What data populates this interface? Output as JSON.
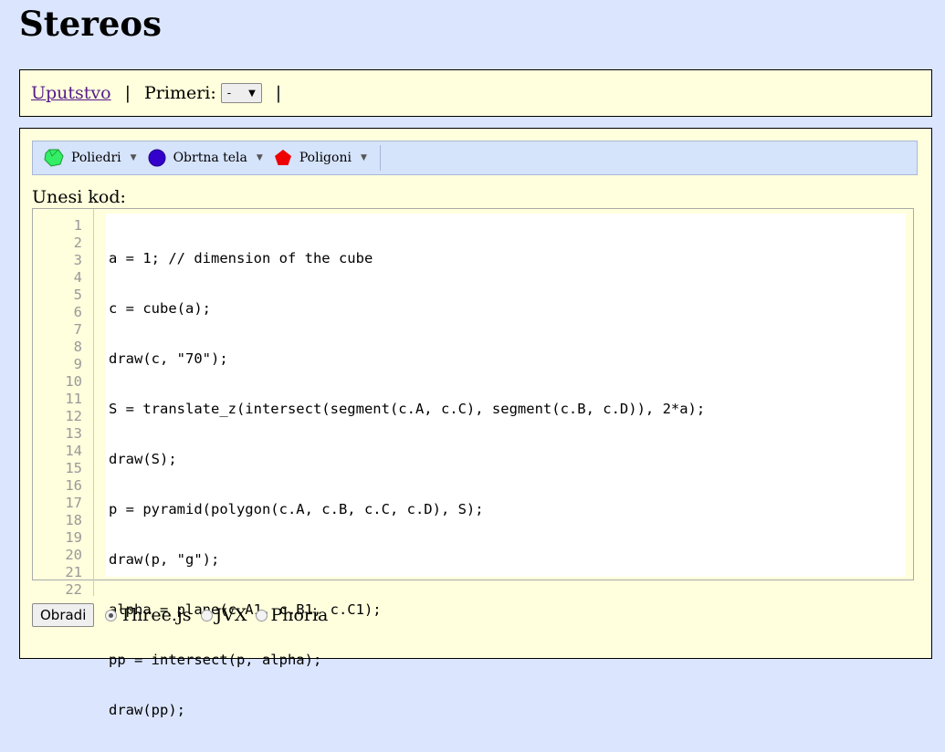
{
  "header": {
    "title": "Stereos"
  },
  "topbar": {
    "help_link": "Uputstvo",
    "separator": "|",
    "examples_label": "Primeri:",
    "examples_selected": "-",
    "select_arrow": "▼"
  },
  "toolbar": {
    "items": [
      {
        "label": "Poliedri",
        "icon": "polyhedron-icon",
        "color": "#33cc55"
      },
      {
        "label": "Obrtna tela",
        "icon": "sphere-icon",
        "color": "#3300cc"
      },
      {
        "label": "Poligoni",
        "icon": "pentagon-icon",
        "color": "#ee0000"
      }
    ],
    "caret": "▼"
  },
  "editor": {
    "label": "Unesi kod:",
    "line_numbers": [
      "1",
      "2",
      "3",
      "4",
      "5",
      "6",
      "7",
      "8",
      "9",
      "10",
      "11",
      "12",
      "13",
      "14",
      "15",
      "16",
      "17",
      "18",
      "19",
      "20",
      "21",
      "22"
    ],
    "lines": [
      "a = 1; // dimension of the cube",
      "c = cube(a);",
      "draw(c, \"70\");",
      "S = translate_z(intersect(segment(c.A, c.C), segment(c.B, c.D)), 2*a);",
      "draw(S);",
      "p = pyramid(polygon(c.A, c.B, c.C, c.D), S);",
      "draw(p, \"g\");",
      "alpha = plane(c.A1, c.B1, c.C1);",
      "pp = intersect(p, alpha);",
      "draw(pp);"
    ]
  },
  "controls": {
    "process_button": "Obradi",
    "renderers": [
      {
        "label": "Three.js",
        "checked": true
      },
      {
        "label": "JVX",
        "checked": false
      },
      {
        "label": "Phoria",
        "checked": false
      }
    ]
  }
}
